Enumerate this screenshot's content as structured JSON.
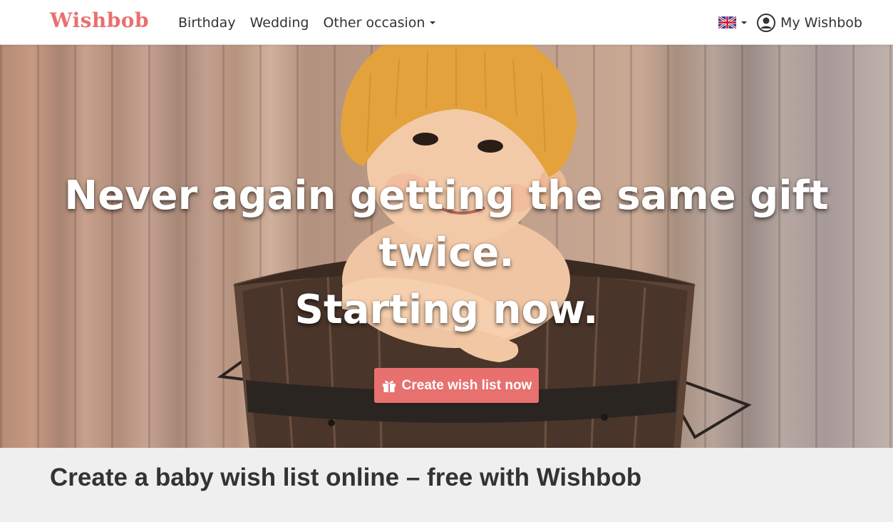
{
  "brand": {
    "logo_text": "Wishbob",
    "accent_color": "#e8706f"
  },
  "nav": {
    "links": [
      {
        "label": "Birthday"
      },
      {
        "label": "Wedding"
      },
      {
        "label": "Other occasion"
      }
    ],
    "language_icon": "uk-flag-icon",
    "account_label": "My Wishbob"
  },
  "hero": {
    "headline_line1": "Never again getting the same gift",
    "headline_line2": "twice.",
    "headline_line3": "Starting now.",
    "cta_label": "Create wish list now",
    "cta_icon": "gift-icon"
  },
  "section": {
    "title": "Create a baby wish list online – free with Wishbob"
  }
}
